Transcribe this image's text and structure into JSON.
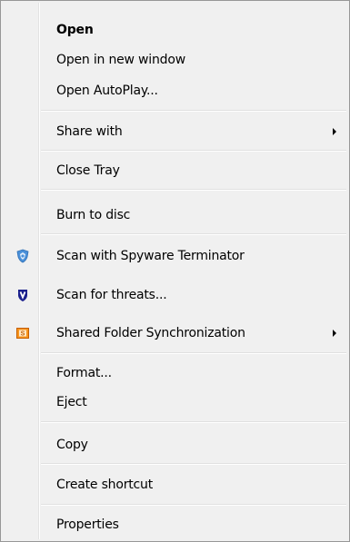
{
  "menu": {
    "items": {
      "open": {
        "label": "Open"
      },
      "open_new_window": {
        "label": "Open in new window"
      },
      "open_autoplay": {
        "label": "Open AutoPlay..."
      },
      "share_with": {
        "label": "Share with"
      },
      "close_tray": {
        "label": "Close Tray"
      },
      "burn_to_disc": {
        "label": "Burn to disc"
      },
      "scan_spyware_terminator": {
        "label": "Scan with Spyware Terminator",
        "icon": "spyware-terminator-shield-icon"
      },
      "scan_for_threats": {
        "label": "Scan for threats...",
        "icon": "antivirus-shield-icon"
      },
      "shared_folder_sync": {
        "label": "Shared Folder Synchronization",
        "icon": "shared-folder-sync-icon"
      },
      "format": {
        "label": "Format..."
      },
      "eject": {
        "label": "Eject"
      },
      "copy": {
        "label": "Copy"
      },
      "create_shortcut": {
        "label": "Create shortcut"
      },
      "properties": {
        "label": "Properties"
      }
    },
    "colors": {
      "background": "#f0f0f0",
      "border": "#979797",
      "text": "#000000"
    }
  }
}
